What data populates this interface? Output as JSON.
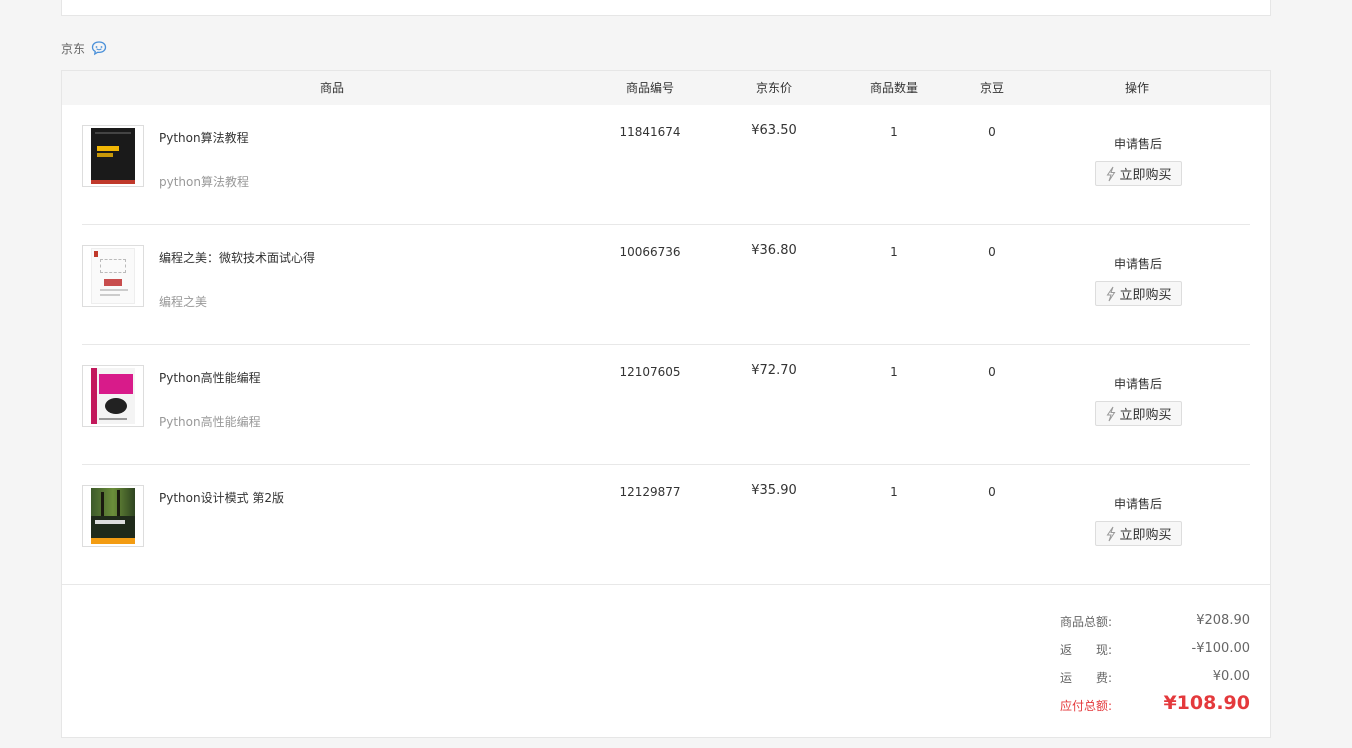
{
  "shop": {
    "name": "京东",
    "icon": "chat-bubble-icon"
  },
  "table": {
    "headers": {
      "product": "商品",
      "sku": "商品编号",
      "price": "京东价",
      "qty": "商品数量",
      "beans": "京豆",
      "action": "操作"
    },
    "rows": [
      {
        "name": "Python算法教程",
        "subtitle": "python算法教程",
        "sku": "11841674",
        "price": "¥63.50",
        "qty": "1",
        "beans": "0",
        "after_sale": "申请售后",
        "buy": "立即购买",
        "cover": "dark-cover"
      },
      {
        "name": "编程之美：微软技术面试心得",
        "subtitle": "编程之美",
        "sku": "10066736",
        "price": "¥36.80",
        "qty": "1",
        "beans": "0",
        "after_sale": "申请售后",
        "buy": "立即购买",
        "cover": "white-cover"
      },
      {
        "name": "Python高性能编程",
        "subtitle": "Python高性能编程",
        "sku": "12107605",
        "price": "¥72.70",
        "qty": "1",
        "beans": "0",
        "after_sale": "申请售后",
        "buy": "立即购买",
        "cover": "magenta-cover"
      },
      {
        "name": "Python设计模式 第2版",
        "subtitle": "",
        "sku": "12129877",
        "price": "¥35.90",
        "qty": "1",
        "beans": "0",
        "after_sale": "申请售后",
        "buy": "立即购买",
        "cover": "forest-cover"
      }
    ]
  },
  "summary": {
    "goods_total_label": "商品总额:",
    "goods_total": "¥208.90",
    "cashback_label": "返　　现:",
    "cashback": "-¥100.00",
    "shipping_label": "运　　费:",
    "shipping": "¥0.00",
    "payable_label": "应付总额:",
    "payable": "¥108.90"
  },
  "colors": {
    "accent": "#e4393c",
    "link_blue": "#4a90d9"
  }
}
